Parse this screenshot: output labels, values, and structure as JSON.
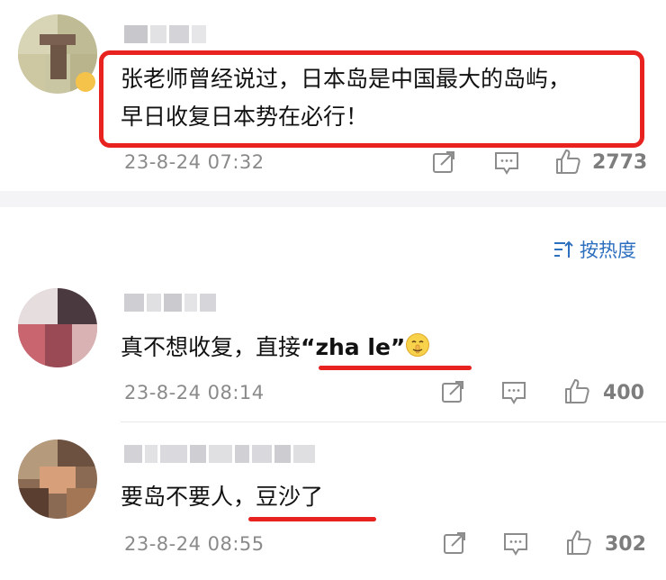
{
  "top_comment": {
    "line1": "张老师曾经说过，日本岛是中国最大的岛屿，",
    "line2": "早日收复日本势在必行！",
    "time": "23-8-24 07:32",
    "likes": "2773"
  },
  "sort": {
    "label": "按热度",
    "icon": "sort-icon"
  },
  "comments": [
    {
      "text": "真不想收复，直接",
      "quote": "“zha le”",
      "emoji": "shush-face-emoji",
      "time": "23-8-24 08:14",
      "likes": "400"
    },
    {
      "text_a": "要岛不要人，",
      "text_b": "豆沙了",
      "time": "23-8-24 08:55",
      "likes": "302"
    }
  ],
  "action_icons": [
    "share-icon",
    "comment-icon",
    "like-icon"
  ],
  "colors": {
    "highlight": "#e7221f",
    "link_blue": "#2d6fbf",
    "meta_gray": "#8a8a8a"
  }
}
